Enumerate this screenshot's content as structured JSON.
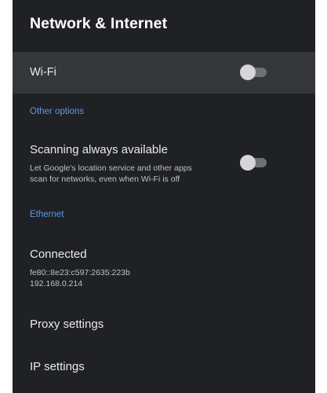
{
  "header": {
    "title": "Network & Internet"
  },
  "wifi": {
    "label": "Wi-Fi",
    "toggle_on": false
  },
  "other_options": {
    "header": "Other options",
    "scanning": {
      "title": "Scanning always available",
      "subtitle_line1": "Let Google's location service and other apps",
      "subtitle_line2": "scan for networks, even when Wi-Fi is off",
      "toggle_on": false
    }
  },
  "ethernet": {
    "header": "Ethernet",
    "status": {
      "title": "Connected",
      "ipv6": "fe80::8e23:c597:2635:223b",
      "ipv4": "192.168.0.214"
    },
    "proxy": {
      "title": "Proxy settings"
    },
    "ip": {
      "title": "IP settings"
    }
  },
  "colors": {
    "background": "#202124",
    "selected_row": "#36373a",
    "accent": "#5e97e8",
    "text_primary": "#e8eaed",
    "text_secondary": "#bdc1c6"
  },
  "icons": {
    "toggle": "toggle-switch-off-icon"
  }
}
